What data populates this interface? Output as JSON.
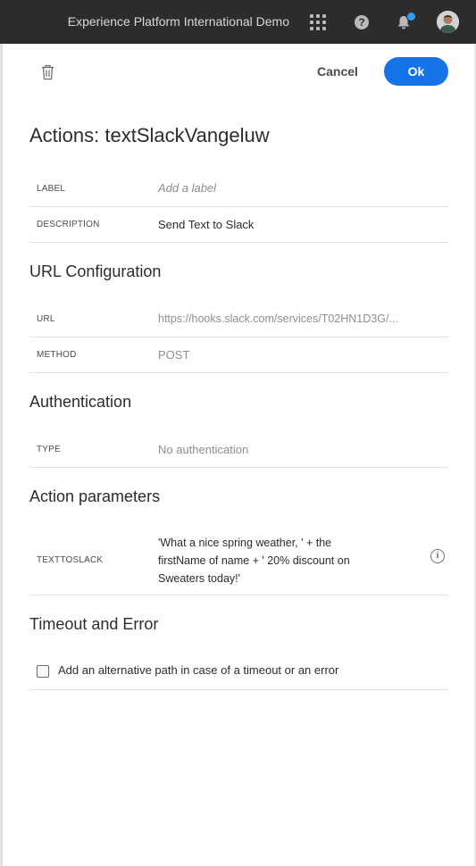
{
  "topbar": {
    "org_name": "Experience Platform International Demo",
    "icons": [
      "apps-grid-icon",
      "help-icon",
      "bell-icon",
      "avatar"
    ],
    "notification_dot_color": "#2d9cec"
  },
  "toolbar": {
    "cancel_label": "Cancel",
    "ok_label": "Ok",
    "accent_color": "#1473e6"
  },
  "page_title": "Actions: textSlackVangeluw",
  "general": {
    "label": {
      "label": "LABEL",
      "placeholder": "Add a label"
    },
    "description": {
      "label": "DESCRIPTION",
      "value": "Send Text to Slack"
    }
  },
  "url_config": {
    "title": "URL Configuration",
    "url": {
      "label": "URL",
      "value": "https://hooks.slack.com/services/T02HN1D3G/..."
    },
    "method": {
      "label": "METHOD",
      "value": "POST"
    }
  },
  "authentication": {
    "title": "Authentication",
    "type": {
      "label": "TYPE",
      "value": "No authentication"
    }
  },
  "action_parameters": {
    "title": "Action parameters",
    "param": {
      "label": "TEXTTOSLACK",
      "value": "'What a nice spring weather, ' + the firstName of name + ' 20% discount on Sweaters today!'"
    }
  },
  "timeout": {
    "title": "Timeout and Error",
    "checkbox_label": "Add an alternative path in case of a timeout or an error",
    "checked": false
  }
}
